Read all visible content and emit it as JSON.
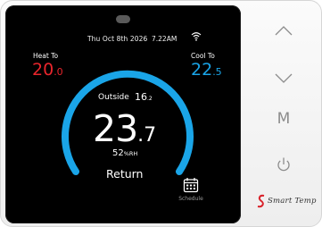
{
  "status": {
    "date": "Thu Oct 8th 2026",
    "time": "7.22AM"
  },
  "setpoints": {
    "heat_label": "Heat To",
    "heat_whole": "20",
    "heat_decimal": ".0",
    "cool_label": "Cool To",
    "cool_whole": "22",
    "cool_decimal": ".5"
  },
  "outside": {
    "label": "Outside",
    "whole": "16",
    "decimal": ".2"
  },
  "indoor": {
    "whole": "23",
    "decimal": ".7"
  },
  "humidity": {
    "value": "52",
    "unit": "%RH"
  },
  "mode_label": "Return",
  "schedule_label": "Schedule",
  "side_panel": {
    "mode_button": "M",
    "brand": "Smart Temp"
  },
  "colors": {
    "heat": "#e8252c",
    "cool": "#1aa5e8",
    "arc": "#1aa5e8"
  },
  "icons": [
    "wifi-icon",
    "calendar-icon",
    "up-arrow-icon",
    "down-arrow-icon",
    "power-icon",
    "smart-temp-logo"
  ]
}
